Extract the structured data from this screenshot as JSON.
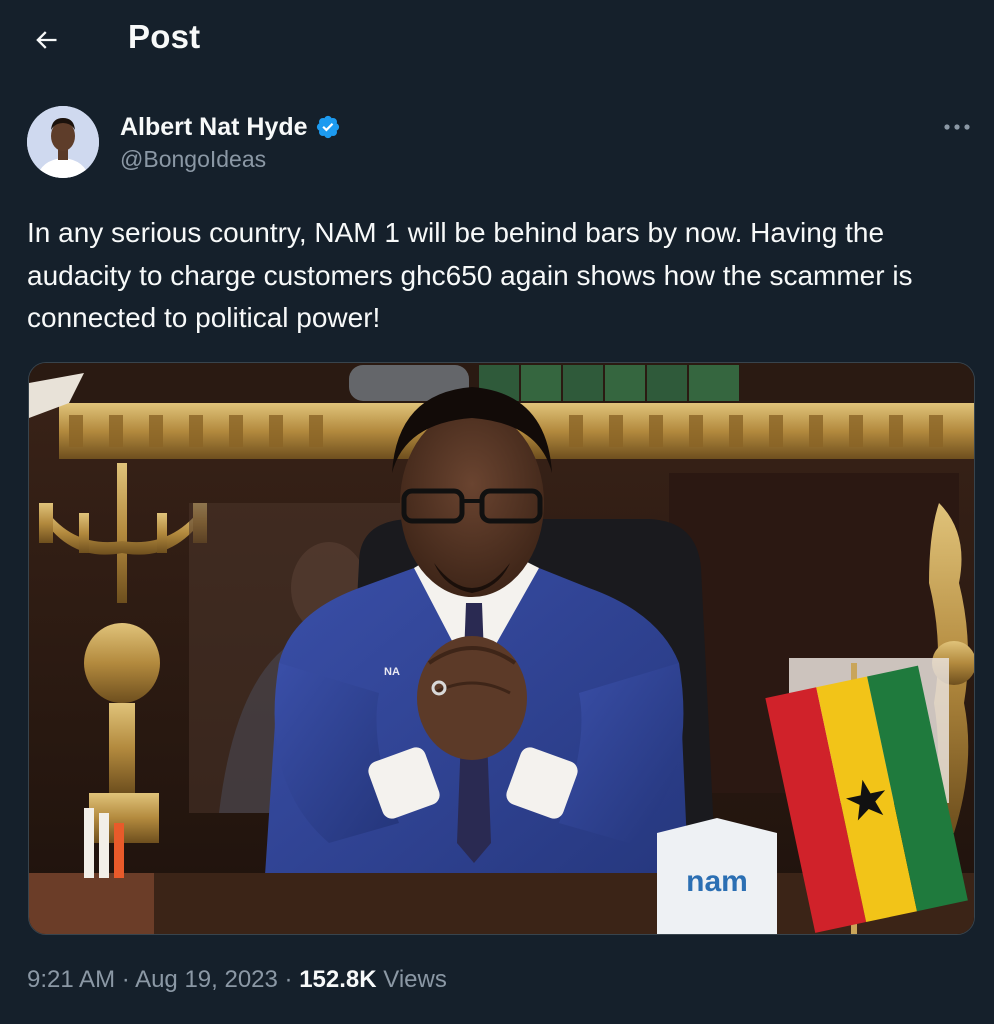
{
  "header": {
    "title": "Post"
  },
  "author": {
    "display_name": "Albert Nat Hyde",
    "handle": "@BongoIdeas",
    "verified": true
  },
  "post": {
    "text": "In any serious country, NAM 1 will be behind bars by now. Having the audacity to charge customers ghc650 again shows how the scammer is connected to political power!",
    "media": {
      "logo_text": "nam",
      "lapel_text": "NA"
    }
  },
  "meta": {
    "time": "9:21 AM",
    "separator": " · ",
    "date": "Aug 19, 2023",
    "views_count": "152.8K",
    "views_label": " Views"
  },
  "icons": {
    "back": "arrow-left-icon",
    "verified": "verified-badge-icon",
    "more": "more-dots-icon"
  },
  "colors": {
    "background": "#15202b",
    "text_primary": "#f7f9f9",
    "text_secondary": "#8b98a5",
    "verified": "#1d9bf0"
  }
}
